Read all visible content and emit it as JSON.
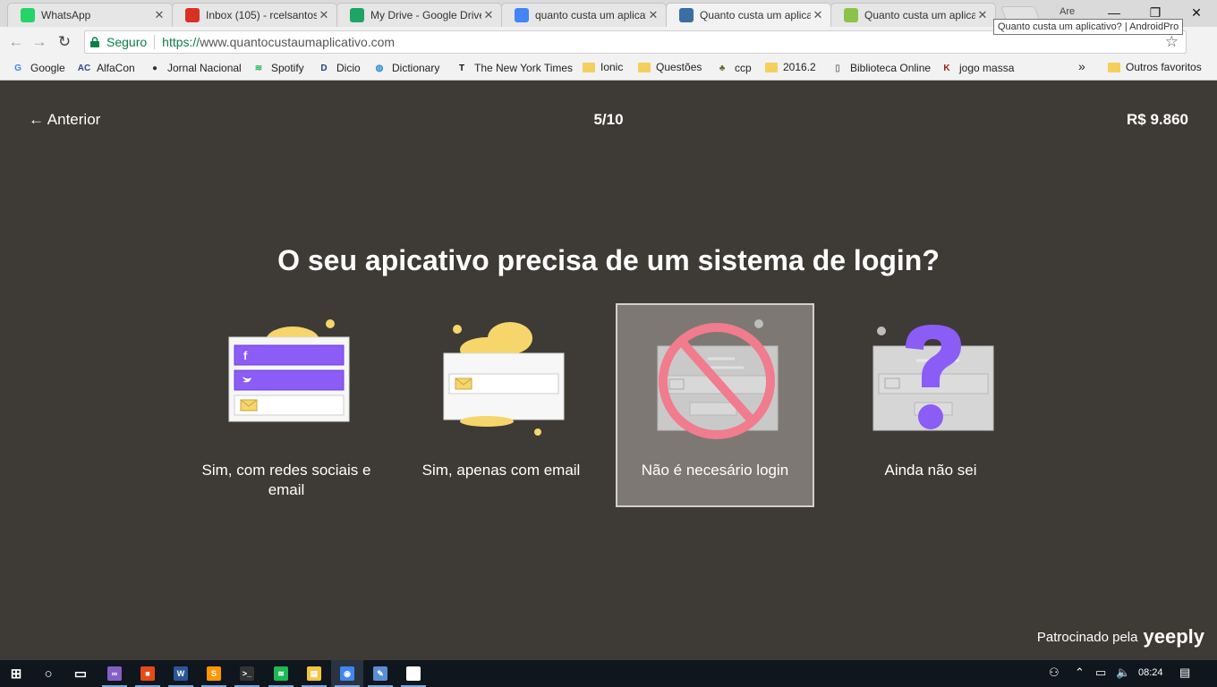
{
  "tabs": [
    {
      "title": "WhatsApp",
      "icon": "whatsapp-icon",
      "color": "#25d366"
    },
    {
      "title": "Inbox (105) - rcelsantos",
      "icon": "gmail-icon",
      "color": "#d93025"
    },
    {
      "title": "My Drive - Google Drive",
      "icon": "drive-icon",
      "color": "#1fa463"
    },
    {
      "title": "quanto custa um aplicativo",
      "icon": "google-icon",
      "color": "#4285f4"
    },
    {
      "title": "Quanto custa um aplicativo",
      "icon": "phone-icon",
      "color": "#3a6ea5"
    },
    {
      "title": "Quanto custa um aplicativo",
      "icon": "androidpro-icon",
      "color": "#8bc34a"
    }
  ],
  "window": {
    "user_label": "Are",
    "minimize": "—",
    "restore": "❐",
    "close": "✕"
  },
  "tooltip": "Quanto custa um aplicativo? | AndroidPro",
  "address_bar": {
    "secure_label": "Seguro",
    "url_scheme": "https://",
    "url_rest": "www.quantocustaumaplicativo.com"
  },
  "bookmarks": [
    {
      "label": "Google",
      "icon": "google-icon",
      "kind": "site",
      "glyph": "G",
      "color": "#4285f4"
    },
    {
      "label": "AlfaCon",
      "icon": "alfacon-icon",
      "kind": "site",
      "glyph": "AC",
      "color": "#2c4a8c"
    },
    {
      "label": "Jornal Nacional",
      "icon": "globo-icon",
      "kind": "site",
      "glyph": "●",
      "color": "#333333"
    },
    {
      "label": "Spotify",
      "icon": "spotify-icon",
      "kind": "site",
      "glyph": "≋",
      "color": "#1db954"
    },
    {
      "label": "Dicio",
      "icon": "dicio-icon",
      "kind": "site",
      "glyph": "D",
      "color": "#1e3f8a"
    },
    {
      "label": "Dictionary",
      "icon": "globe-icon",
      "kind": "site",
      "glyph": "◍",
      "color": "#2a8fd6"
    },
    {
      "label": "The New York Times",
      "icon": "nyt-icon",
      "kind": "site",
      "glyph": "T",
      "color": "#111111"
    },
    {
      "label": "Ionic",
      "icon": "folder-icon",
      "kind": "folder"
    },
    {
      "label": "Questões",
      "icon": "folder-icon",
      "kind": "folder"
    },
    {
      "label": "ccp",
      "icon": "ccp-icon",
      "kind": "site",
      "glyph": "♣",
      "color": "#556b2f"
    },
    {
      "label": "2016.2",
      "icon": "folder-icon",
      "kind": "folder"
    },
    {
      "label": "Biblioteca Online",
      "icon": "page-icon",
      "kind": "site",
      "glyph": "▯",
      "color": "#777777"
    },
    {
      "label": "jogo massa",
      "icon": "kongregate-icon",
      "kind": "site",
      "glyph": "K",
      "color": "#9b1c1c"
    }
  ],
  "bookmarks_overflow": "»",
  "other_bookmarks": "Outros favoritos",
  "page": {
    "back_label": "← Anterior",
    "step": "5/10",
    "price": "R$ 9.860",
    "question": "O seu apicativo precisa de um sistema de login?",
    "selected_option": 2,
    "options": [
      {
        "label": "Sim, com redes sociais e email",
        "icon": "social-login-icon"
      },
      {
        "label": "Sim, apenas com email",
        "icon": "email-login-icon"
      },
      {
        "label": "Não é necesário login",
        "icon": "no-login-icon"
      },
      {
        "label": "Ainda não sei",
        "icon": "question-mark-icon"
      }
    ],
    "sponsor_prefix": "Patrocinado pela",
    "sponsor_brand": "yeeply"
  },
  "colors": {
    "background": "#3e3a36",
    "accent_purple": "#8b5cf6",
    "accent_yellow": "#f6d56a",
    "forbidden_pink": "#f07c8e"
  },
  "taskbar": {
    "time": "08:24",
    "apps": [
      "windows-icon",
      "cortana-icon",
      "task-view-icon",
      "visual-studio-icon",
      "office-icon",
      "word-icon",
      "sublime-icon",
      "cmd-icon",
      "spotify-icon",
      "file-explorer-icon",
      "chrome-icon",
      "paint-icon",
      "photos-icon"
    ]
  }
}
